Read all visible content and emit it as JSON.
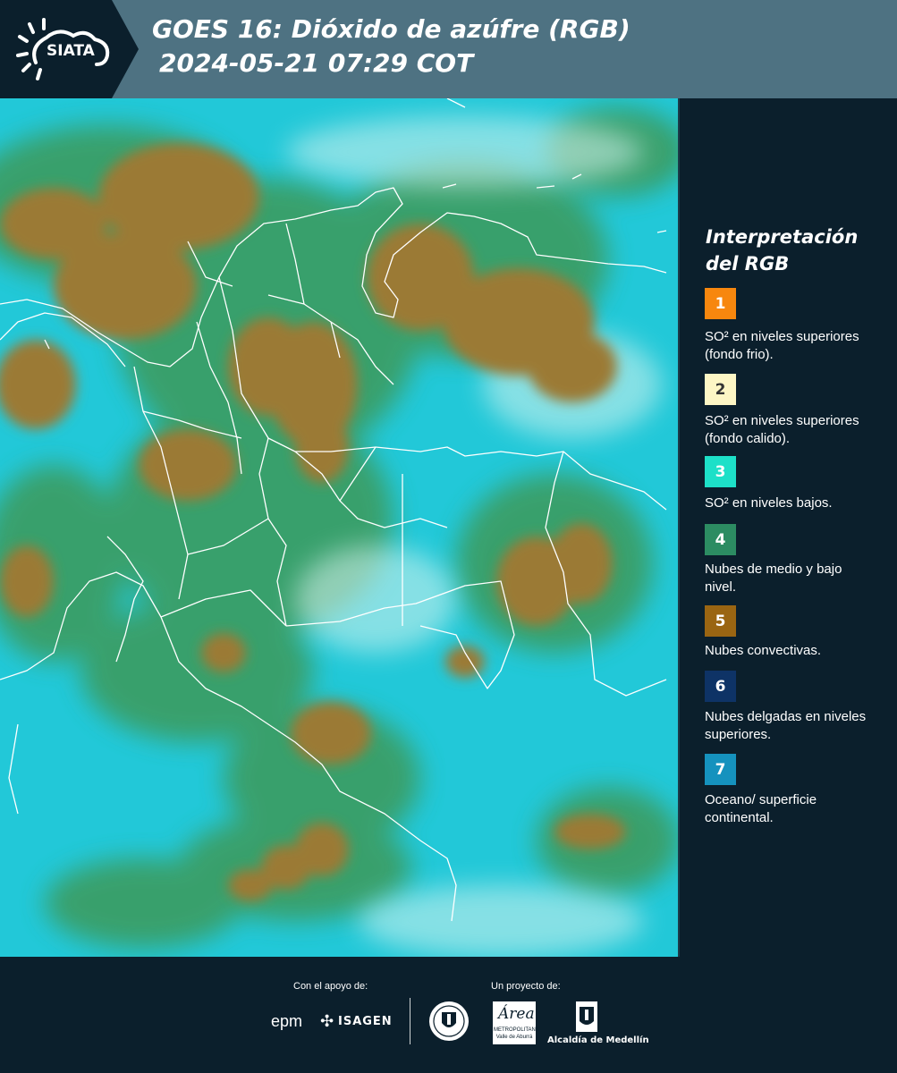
{
  "header": {
    "brand": "SIATA",
    "title_line1": "GOES 16: Dióxido de azúfre (RGB)",
    "title_line2": "2024-05-21 07:29 COT"
  },
  "legend": {
    "title": "Interpretación del RGB",
    "items": [
      {
        "number": "1",
        "color": "#f7870e",
        "text_color": "#ffffff",
        "label": "SO² en niveles superiores (fondo frio)."
      },
      {
        "number": "2",
        "color": "#fdf6c5",
        "text_color": "#333333",
        "label": "SO² en niveles superiores (fondo calido)."
      },
      {
        "number": "3",
        "color": "#1de0c8",
        "text_color": "#ffffff",
        "label": "SO² en niveles bajos."
      },
      {
        "number": "4",
        "color": "#2c8c62",
        "text_color": "#ffffff",
        "label": "Nubes de medio y bajo nivel."
      },
      {
        "number": "5",
        "color": "#9a6512",
        "text_color": "#ffffff",
        "label": "Nubes convectivas."
      },
      {
        "number": "6",
        "color": "#0e3366",
        "text_color": "#ffffff",
        "label": "Nubes delgadas en niveles superiores."
      },
      {
        "number": "7",
        "color": "#1592be",
        "text_color": "#ffffff",
        "label": "Oceano/ superficie continental."
      }
    ]
  },
  "footer": {
    "support_caption": "Con el apoyo de:",
    "project_caption": "Un proyecto de:",
    "sponsor_epm": "epm",
    "sponsor_isagen": "ISAGEN",
    "partner_area_script": "Área",
    "partner_area_line1": "METROPOLITANA",
    "partner_area_line2": "Valle de Aburrá",
    "partner_alcaldia": "Alcaldía de Medellín"
  },
  "map_colors": {
    "cloud_brown": "#9b7a35",
    "ocean_cyan": "#22c8d8",
    "low_green": "#3e9a5a",
    "border": "#ffffff"
  }
}
